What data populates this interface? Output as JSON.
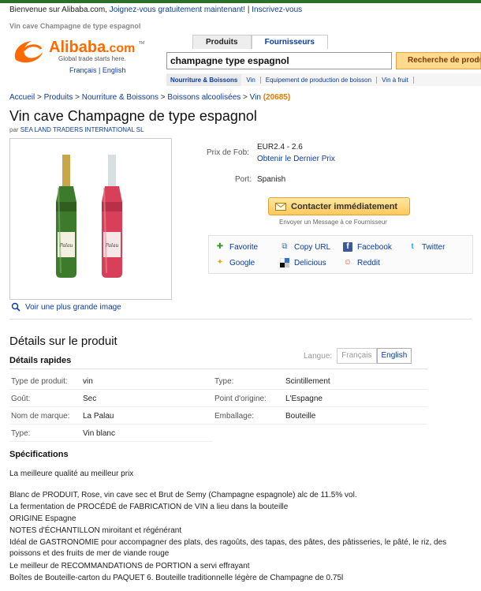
{
  "header": {
    "welcome_text": "Bienvenue sur Alibaba.com,",
    "join_link": "Joignez-vous gratuitement maintenant!",
    "sep": "|",
    "register_link": "Inscrivez-vous",
    "top_crumb": "Vin cave Champagne de type espagnol"
  },
  "logo": {
    "brand": "Alibaba",
    "tld": ".com",
    "tagline": "Global trade starts here.",
    "tm": "TM",
    "lang_fr": "Français",
    "lang_sep": "|",
    "lang_en": "English"
  },
  "search": {
    "tab_products": "Produits",
    "tab_suppliers": "Fournisseurs",
    "query": "champagne type espagnol",
    "button": "Recherche de produits"
  },
  "categories": [
    "Nourriture & Boissons",
    "Vin",
    "Equipement de production de boisson",
    "Vin à fruit"
  ],
  "breadcrumb": {
    "items": [
      "Accueil",
      "Produits",
      "Nourriture & Boissons",
      "Boissons alcoolisées",
      "Vin"
    ],
    "sep": ">",
    "count": "(20685)"
  },
  "product": {
    "title": "Vin cave Champagne de type espagnol",
    "by": "par",
    "seller": "SEA LAND TRADERS INTERNATIONAL SL",
    "zoom_link": "Voir une plus grande image",
    "bottle_label": "Palau",
    "fob_label": "Prix de Fob:",
    "fob_price": "EUR2.4 - 2.6",
    "fob_link": "Obtenir le Dernier Prix",
    "port_label": "Port:",
    "port_value": "Spanish",
    "contact_button": "Contacter immédiatement",
    "contact_note": "Envoyer un Message à ce Fournisseur"
  },
  "share": {
    "favorite": "Favorite",
    "copy_url": "Copy URL",
    "facebook": "Facebook",
    "twitter": "Twitter",
    "google": "Google",
    "delicious": "Delicious",
    "reddit": "Reddit"
  },
  "details": {
    "title": "Détails sur le produit",
    "quick": "Détails rapides",
    "lang_label": "Langue:",
    "lang_fr": "Français",
    "lang_en": "English",
    "attrs_left": [
      {
        "k": "Type de produit:",
        "v": "vin"
      },
      {
        "k": "Goût:",
        "v": "Sec"
      },
      {
        "k": "Nom de marque:",
        "v": "La Palau"
      },
      {
        "k": "Type:",
        "v": "Vin blanc"
      }
    ],
    "attrs_right": [
      {
        "k": "Type:",
        "v": "Scintillement"
      },
      {
        "k": "Point d'origine:",
        "v": "L'Espagne"
      },
      {
        "k": "Emballage:",
        "v": "Bouteille"
      }
    ]
  },
  "specs": {
    "title": "Spécifications",
    "lines": [
      "La meilleure qualité au meilleur prix",
      "Blanc de PRODUIT, Rose, vin cave sec et Brut de Semy (Champagne espagnole) alc de 11.5% vol.",
      "La fermentation de PROCÉDÉ de FABRICATION de VIN a lieu dans la bouteille",
      "ORIGINE Espagne",
      "NOTES d'ÉCHANTILLON miroitant et régénérant",
      "Idéal de GASTRONOMIE pour accompagner des plats, des ragoûts, des tapas, des pâtes, des pâtisseries, le pâté, le riz, des poissons et des fruits de mer de viande rouge",
      "Le meilleur de RECOMMANDATIONS de PORTION a servi effrayant",
      "Boîtes de Bouteille-carton du PAQUET 6. Bouteille traditionnelle légère de Champagne de 0.75l"
    ]
  },
  "colors": {
    "link": "#0b3b9c",
    "accent_orange": "#e07a00",
    "button_yellow": "#ffc95a"
  }
}
